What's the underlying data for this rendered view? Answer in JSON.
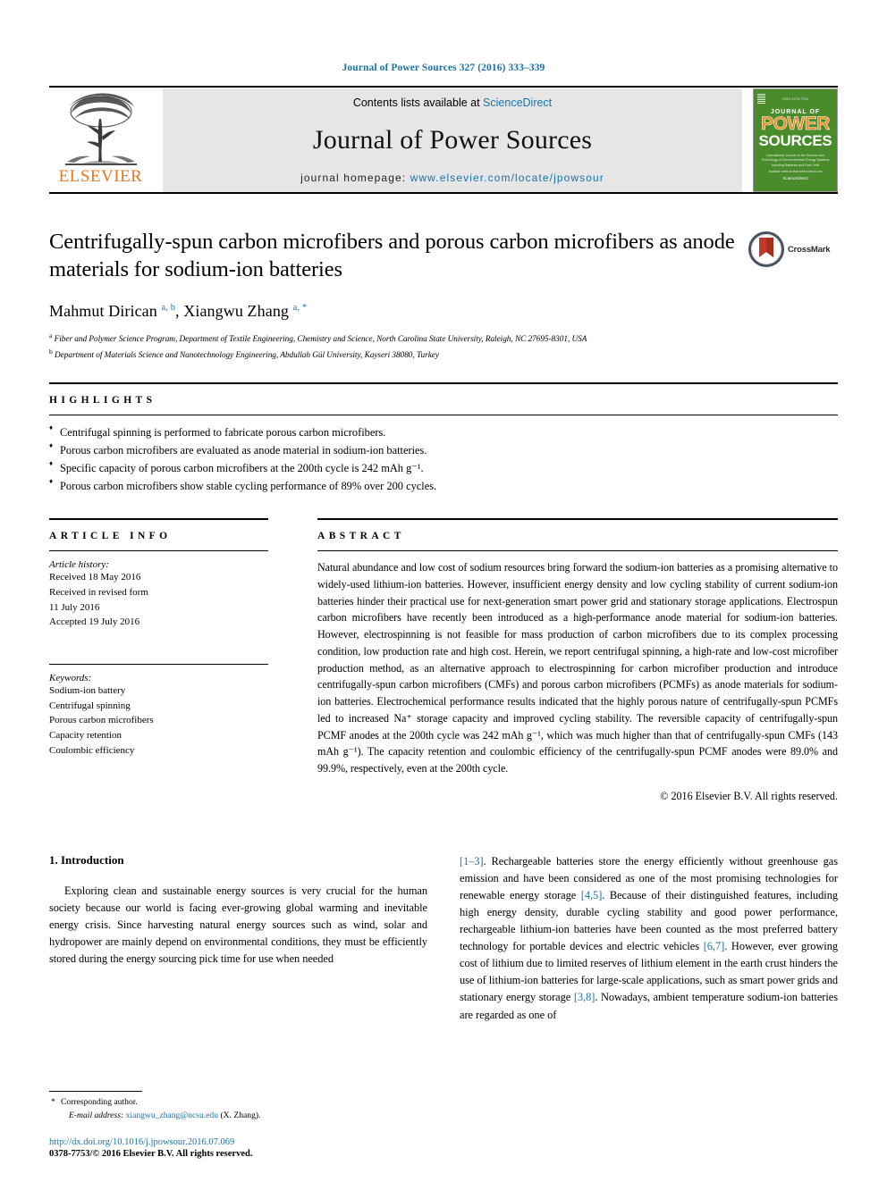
{
  "running_head": "Journal of Power Sources 327 (2016) 333–339",
  "masthead": {
    "contents_prefix": "Contents lists available at ",
    "sciencedirect": "ScienceDirect",
    "journal_title": "Journal of Power Sources",
    "homepage_prefix": "journal homepage: ",
    "homepage_url": "www.elsevier.com/locate/jpowsour",
    "publisher": "ELSEVIER",
    "cover": {
      "line_journal_of": "JOURNAL OF",
      "line_power": "POWER",
      "line_sources": "SOURCES",
      "subtitle": "International Journal on the Science and Technology of Electrochemical Energy Systems including Batteries and Fuel Cells",
      "footer_small": "Available online at www.sciencedirect.com",
      "footer_brand": "ScienceDirect"
    },
    "colors": {
      "link_blue": "#1b72a8",
      "elsevier_orange": "#e87722",
      "cover_green": "#4a8b2c",
      "cover_power_orange": "#f08a1d",
      "panel_gray": "#e6e6e6"
    }
  },
  "article": {
    "title": "Centrifugally-spun carbon microfibers and porous carbon microfibers as anode materials for sodium-ion batteries",
    "crossmark_label": "CrossMark",
    "authors_html": "Mahmut Dirican <sup>a, b</sup>, Xiangwu Zhang <sup>a, *</sup>",
    "affiliations": [
      {
        "marker": "a",
        "text": "Fiber and Polymer Science Program, Department of Textile Engineering, Chemistry and Science, North Carolina State University, Raleigh, NC 27695-8301, USA"
      },
      {
        "marker": "b",
        "text": "Department of Materials Science and Nanotechnology Engineering, Abdullah Gül University, Kayseri 38080, Turkey"
      }
    ]
  },
  "highlights": {
    "heading": "HIGHLIGHTS",
    "items": [
      "Centrifugal spinning is performed to fabricate porous carbon microfibers.",
      "Porous carbon microfibers are evaluated as anode material in sodium-ion batteries.",
      "Specific capacity of porous carbon microfibers at the 200th cycle is 242 mAh g⁻¹.",
      "Porous carbon microfibers show stable cycling performance of 89% over 200 cycles."
    ]
  },
  "article_info": {
    "heading": "ARTICLE INFO",
    "history_label": "Article history:",
    "history": [
      "Received 18 May 2016",
      "Received in revised form",
      "11 July 2016",
      "Accepted 19 July 2016"
    ],
    "keywords_label": "Keywords:",
    "keywords": [
      "Sodium-ion battery",
      "Centrifugal spinning",
      "Porous carbon microfibers",
      "Capacity retention",
      "Coulombic efficiency"
    ]
  },
  "abstract": {
    "heading": "ABSTRACT",
    "text": "Natural abundance and low cost of sodium resources bring forward the sodium-ion batteries as a promising alternative to widely-used lithium-ion batteries. However, insufficient energy density and low cycling stability of current sodium-ion batteries hinder their practical use for next-generation smart power grid and stationary storage applications. Electrospun carbon microfibers have recently been introduced as a high-performance anode material for sodium-ion batteries. However, electrospinning is not feasible for mass production of carbon microfibers due to its complex processing condition, low production rate and high cost. Herein, we report centrifugal spinning, a high-rate and low-cost microfiber production method, as an alternative approach to electrospinning for carbon microfiber production and introduce centrifugally-spun carbon microfibers (CMFs) and porous carbon microfibers (PCMFs) as anode materials for sodium-ion batteries. Electrochemical performance results indicated that the highly porous nature of centrifugally-spun PCMFs led to increased Na⁺ storage capacity and improved cycling stability. The reversible capacity of centrifugally-spun PCMF anodes at the 200th cycle was 242 mAh g⁻¹, which was much higher than that of centrifugally-spun CMFs (143 mAh g⁻¹). The capacity retention and coulombic efficiency of the centrifugally-spun PCMF anodes were 89.0% and 99.9%, respectively, even at the 200th cycle.",
    "copyright": "© 2016 Elsevier B.V. All rights reserved."
  },
  "introduction": {
    "heading": "1. Introduction",
    "left_paragraph": "Exploring clean and sustainable energy sources is very crucial for the human society because our world is facing ever-growing global warming and inevitable energy crisis. Since harvesting natural energy sources such as wind, solar and hydropower are mainly depend on environmental conditions, they must be efficiently stored during the energy sourcing pick time for use when needed",
    "right_paragraph_segments": [
      {
        "type": "cite",
        "text": "[1–3]"
      },
      {
        "type": "text",
        "text": ". Rechargeable batteries store the energy efficiently without greenhouse gas emission and have been considered as one of the most promising technologies for renewable energy storage "
      },
      {
        "type": "cite",
        "text": "[4,5]"
      },
      {
        "type": "text",
        "text": ". Because of their distinguished features, including high energy density, durable cycling stability and good power performance, rechargeable lithium-ion batteries have been counted as the most preferred battery technology for portable devices and electric vehicles "
      },
      {
        "type": "cite",
        "text": "[6,7]"
      },
      {
        "type": "text",
        "text": ". However, ever growing cost of lithium due to limited reserves of lithium element in the earth crust hinders the use of lithium-ion batteries for large-scale applications, such as smart power grids and stationary energy storage "
      },
      {
        "type": "cite",
        "text": "[3,8]"
      },
      {
        "type": "text",
        "text": ". Nowadays, ambient temperature sodium-ion batteries are regarded as one of"
      }
    ]
  },
  "footer": {
    "corresponding_star": "*",
    "corresponding_label": "Corresponding author.",
    "email_label": "E-mail address:",
    "email": "xiangwu_zhang@ncsu.edu",
    "email_suffix": "(X. Zhang).",
    "doi": "http://dx.doi.org/10.1016/j.jpowsour.2016.07.069",
    "issn": "0378-7753/© 2016 Elsevier B.V. All rights reserved."
  }
}
